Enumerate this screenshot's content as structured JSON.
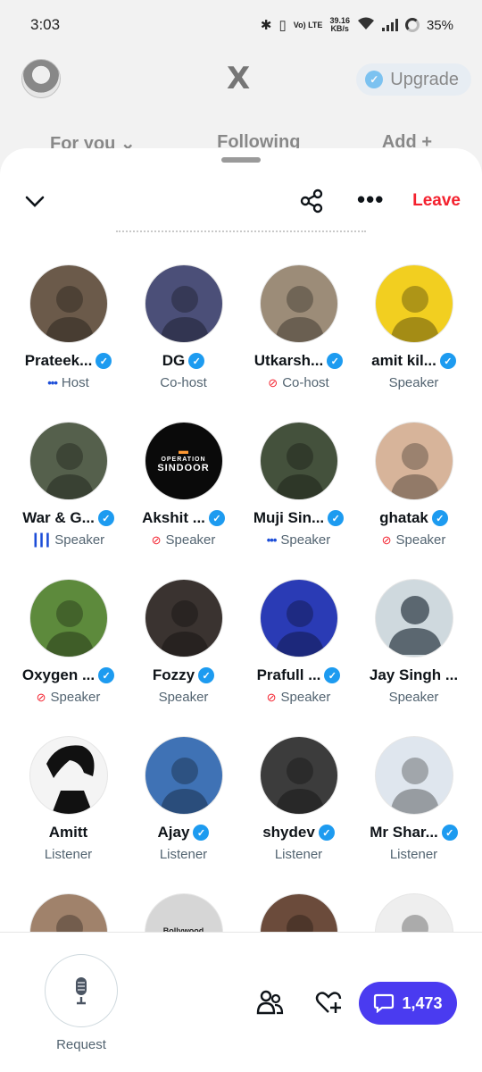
{
  "status_bar": {
    "time": "3:03",
    "network_speed_value": "39.16",
    "network_speed_unit": "KB/s",
    "volte_label": "Vo) LTE",
    "battery": "35%",
    "icons": [
      "bluetooth-icon",
      "vibrate-icon",
      "wifi-icon",
      "signal-icon",
      "battery-icon"
    ]
  },
  "app_header": {
    "logo": "X",
    "upgrade_label": "Upgrade",
    "tabs": [
      "For you",
      "Following",
      "Add"
    ]
  },
  "space": {
    "leave_label": "Leave",
    "participants": [
      {
        "name": "Prateek...",
        "verified": true,
        "role": "Host",
        "role_icon": "speaking-dots-icon",
        "avatar_color": "#6b5a4a"
      },
      {
        "name": "DG",
        "verified": true,
        "role": "Co-host",
        "role_icon": "",
        "avatar_color": "#4b4f78"
      },
      {
        "name": "Utkarsh...",
        "verified": true,
        "role": "Co-host",
        "role_icon": "muted-mic-icon",
        "avatar_color": "#9c8c78"
      },
      {
        "name": "amit kil...",
        "verified": true,
        "role": "Speaker",
        "role_icon": "",
        "avatar_color": "#f2cf20"
      },
      {
        "name": "War & G...",
        "verified": true,
        "role": "Speaker",
        "role_icon": "audio-bars-icon",
        "avatar_color": "#55604c"
      },
      {
        "name": "Akshit ...",
        "verified": true,
        "role": "Speaker",
        "role_icon": "muted-mic-icon",
        "avatar_color": "#0a0a0a"
      },
      {
        "name": "Muji Sin...",
        "verified": true,
        "role": "Speaker",
        "role_icon": "speaking-dots-icon",
        "avatar_color": "#44513c"
      },
      {
        "name": "ghatak",
        "verified": true,
        "role": "Speaker",
        "role_icon": "muted-mic-icon",
        "avatar_color": "#d7b49a"
      },
      {
        "name": "Oxygen ...",
        "verified": true,
        "role": "Speaker",
        "role_icon": "muted-mic-icon",
        "avatar_color": "#5d8a3c"
      },
      {
        "name": "Fozzy",
        "verified": true,
        "role": "Speaker",
        "role_icon": "",
        "avatar_color": "#3a3330"
      },
      {
        "name": "Prafull ...",
        "verified": true,
        "role": "Speaker",
        "role_icon": "muted-mic-icon",
        "avatar_color": "#2a3bb5"
      },
      {
        "name": "Jay Singh ...",
        "verified": false,
        "role": "Speaker",
        "role_icon": "",
        "avatar_color": "#cfd9de"
      },
      {
        "name": "Amitt",
        "verified": false,
        "role": "Listener",
        "role_icon": "",
        "avatar_color": "#f4f4f4"
      },
      {
        "name": "Ajay",
        "verified": true,
        "role": "Listener",
        "role_icon": "",
        "avatar_color": "#3f72b5"
      },
      {
        "name": "shydev",
        "verified": true,
        "role": "Listener",
        "role_icon": "",
        "avatar_color": "#3c3c3c"
      },
      {
        "name": "Mr Shar...",
        "verified": true,
        "role": "Listener",
        "role_icon": "",
        "avatar_color": "#dfe6ee"
      },
      {
        "name": "",
        "verified": false,
        "role": "",
        "role_icon": "",
        "avatar_color": "#a0826b"
      },
      {
        "name": "",
        "verified": false,
        "role": "",
        "role_icon": "",
        "avatar_color": "#d6d6d6"
      },
      {
        "name": "",
        "verified": false,
        "role": "",
        "role_icon": "",
        "avatar_color": "#6b4b3b"
      },
      {
        "name": "",
        "verified": false,
        "role": "",
        "role_icon": "",
        "avatar_color": "#eeeeee"
      }
    ],
    "avatar_text": {
      "operation": "OPERATION",
      "sindoor": "SINDOOR",
      "bollywood": "Bollywood"
    }
  },
  "bottom_bar": {
    "request_label": "Request",
    "chat_count": "1,473"
  },
  "colors": {
    "accent": "#1d9bf0",
    "leave": "#f4212e",
    "chat_button": "#4a3bf0",
    "muted": "#f4212e"
  }
}
